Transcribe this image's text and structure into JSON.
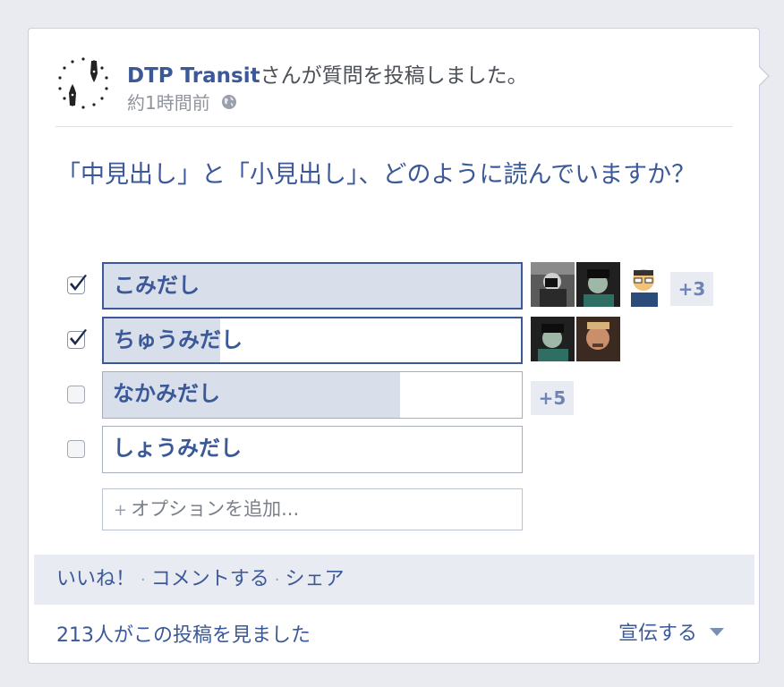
{
  "post": {
    "author": "DTP Transit",
    "action": "さんが質問を投稿しました。",
    "time": "約1時間前",
    "globe_icon": "globe-icon",
    "question": "「中見出し」と「小見出し」、どのように読んでいますか？"
  },
  "options": [
    {
      "label": "こみだし",
      "checked": true,
      "fill_pct": 100,
      "voters": [
        "voter-avatar-1",
        "voter-avatar-2",
        "voter-avatar-3"
      ],
      "more": "+3"
    },
    {
      "label": "ちゅうみだし",
      "checked": true,
      "fill_pct": 28,
      "voters": [
        "voter-avatar-4",
        "voter-avatar-5"
      ],
      "more": ""
    },
    {
      "label": "なかみだし",
      "checked": false,
      "fill_pct": 71,
      "voters": [],
      "more": "+5"
    },
    {
      "label": "しょうみだし",
      "checked": false,
      "fill_pct": 0,
      "voters": [],
      "more": ""
    }
  ],
  "add_option": {
    "plus": "+",
    "label": "オプションを追加..."
  },
  "actions": {
    "like": "いいね！",
    "comment": "コメントする",
    "share": "シェア",
    "separator": "·"
  },
  "footer": {
    "views": "213人がこの投稿を見ました",
    "promote": "宣伝する"
  },
  "colors": {
    "accent": "#3b5998",
    "bar_fill": "#d8dfea",
    "page_bg": "#e9ebf1"
  }
}
